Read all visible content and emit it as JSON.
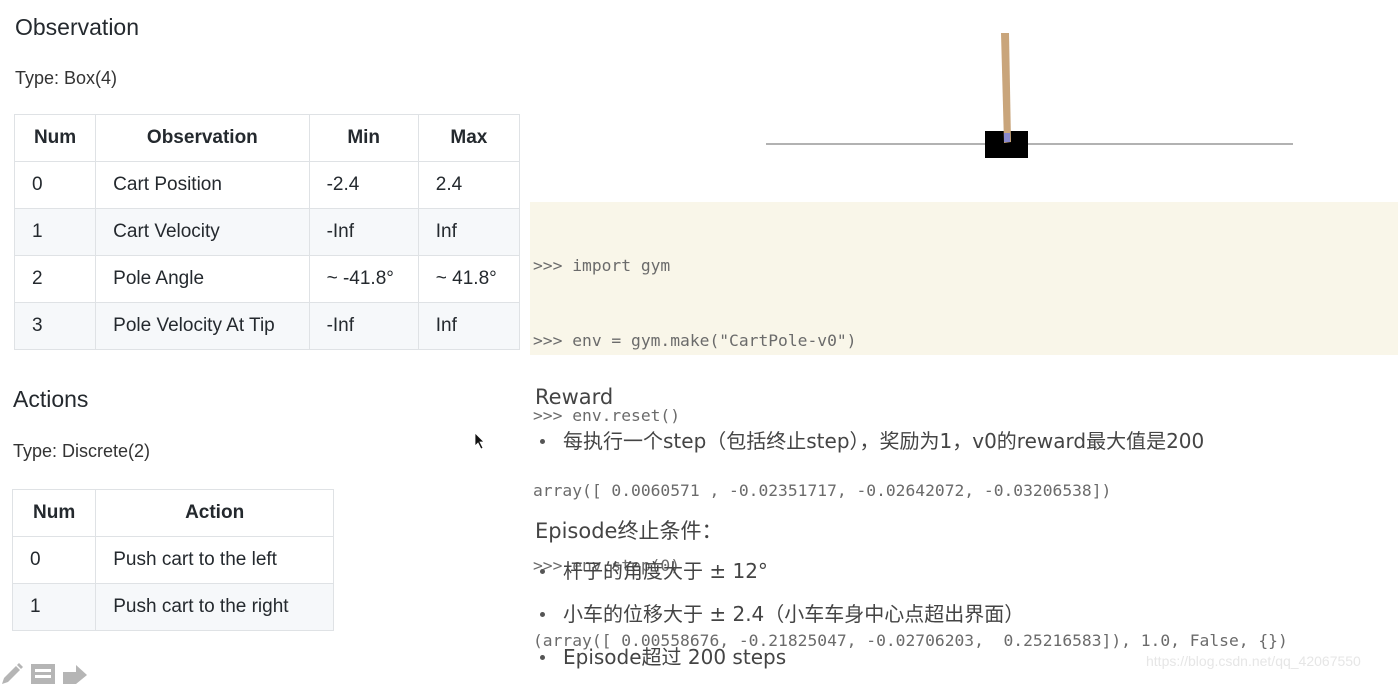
{
  "observation": {
    "title": "Observation",
    "type_line": "Type: Box(4)",
    "table": {
      "headers": [
        "Num",
        "Observation",
        "Min",
        "Max"
      ],
      "rows": [
        [
          "0",
          "Cart Position",
          "-2.4",
          "2.4"
        ],
        [
          "1",
          "Cart Velocity",
          "-Inf",
          "Inf"
        ],
        [
          "2",
          "Pole Angle",
          "~ -41.8°",
          "~ 41.8°"
        ],
        [
          "3",
          "Pole Velocity At Tip",
          "-Inf",
          "Inf"
        ]
      ]
    }
  },
  "actions": {
    "title": "Actions",
    "type_line": "Type: Discrete(2)",
    "table": {
      "headers": [
        "Num",
        "Action"
      ],
      "rows": [
        [
          "0",
          "Push cart to the left"
        ],
        [
          "1",
          "Push cart to the right"
        ]
      ]
    }
  },
  "toolbar": {
    "icons": [
      "pencil-icon",
      "note-icon",
      "share-arrow-icon"
    ]
  },
  "render": {
    "pole_color": "#c9a57b",
    "axle_color": "#8888cc",
    "cart_color": "#000000",
    "track_color": "#999999"
  },
  "code": {
    "lines": [
      ">>> import gym",
      ">>> env = gym.make(\"CartPole-v0\")",
      ">>> env.reset()",
      "array([ 0.0060571 , -0.02351717, -0.02642072, -0.03206538])",
      ">>> env.step(0)",
      "(array([ 0.00558676, -0.21825047, -0.02706203,  0.25216583]), 1.0, False, {})"
    ],
    "background": "#f9f6e9"
  },
  "reward": {
    "title": "Reward",
    "bullets": [
      "每执行一个step（包括终止step），奖励为1，v0的reward最大值是200"
    ]
  },
  "episode": {
    "title": "Episode终止条件：",
    "bullets": [
      "杆子的角度大于 ± 12°",
      "小车的位移大于 ± 2.4（小车车身中心点超出界面）",
      "Episode超过 200 steps"
    ]
  },
  "watermark": "https://blog.csdn.net/qq_42067550"
}
